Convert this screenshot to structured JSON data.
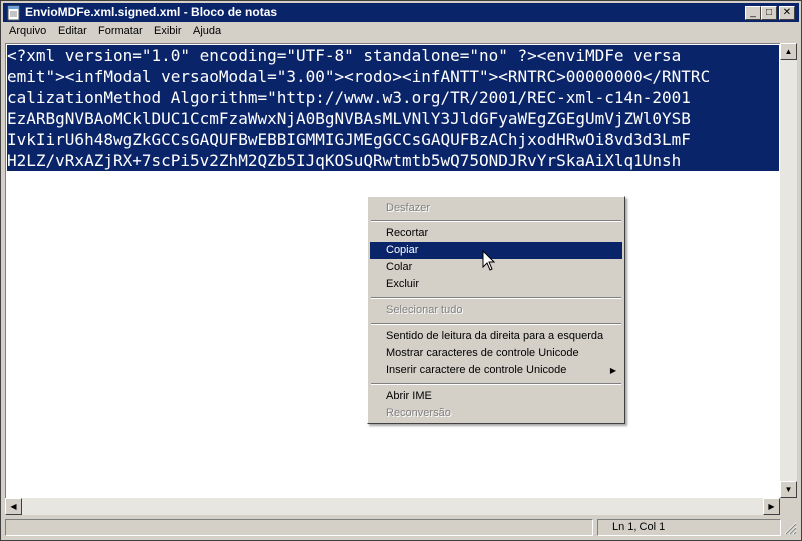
{
  "window": {
    "title": "EnvioMDFe.xml.signed.xml - Bloco de notas",
    "controls": {
      "minimize": "_",
      "maximize": "□",
      "close": "✕"
    }
  },
  "menubar": [
    "Arquivo",
    "Editar",
    "Formatar",
    "Exibir",
    "Ajuda"
  ],
  "editor": {
    "lines": [
      "<?xml version=\"1.0\" encoding=\"UTF-8\" standalone=\"no\" ?><enviMDFe versa",
      "emit\"><infModal versaoModal=\"3.00\"><rodo><infANTT\"><RNTRC>00000000</RNTRC",
      "calizationMethod Algorithm=\"http://www.w3.org/TR/2001/REC-xml-c14n-2001",
      "EzARBgNVBAoMCklDUC1CcmFzaWwxNjA0BgNVBAsMLVNlY3JldGFyaWEgZGEgUmVjZWl0YSB",
      "IvkIirU6h48wgZkGCCsGAQUFBwEBBIGMMIGJMEgGCCsGAQUFBzAChjxodHRwOi8vd3d3LmF",
      "H2LZ/vRxAZjRX+7scPi5v2ZhM2QZb5IJqKOSuQRwtmtb5wQ75ONDJRvYrSkaAiXlq1Unsh"
    ]
  },
  "statusbar": {
    "position": "Ln 1, Col 1"
  },
  "context_menu": {
    "items": [
      {
        "label": "Desfazer",
        "disabled": true
      },
      {
        "label": "Recortar"
      },
      {
        "label": "Copiar",
        "selected": true
      },
      {
        "label": "Colar"
      },
      {
        "label": "Excluir"
      },
      {
        "label": "Selecionar tudo",
        "disabled": true
      },
      {
        "label": "Sentido de leitura da direita para a esquerda"
      },
      {
        "label": "Mostrar caracteres de controle Unicode"
      },
      {
        "label": "Inserir caractere de controle Unicode",
        "submenu": true
      },
      {
        "label": "Abrir IME"
      },
      {
        "label": "Reconversão",
        "disabled": true
      }
    ]
  },
  "colors": {
    "selection": "#0a246a",
    "face": "#d4d0c8",
    "title_bar": "#0a246a"
  }
}
